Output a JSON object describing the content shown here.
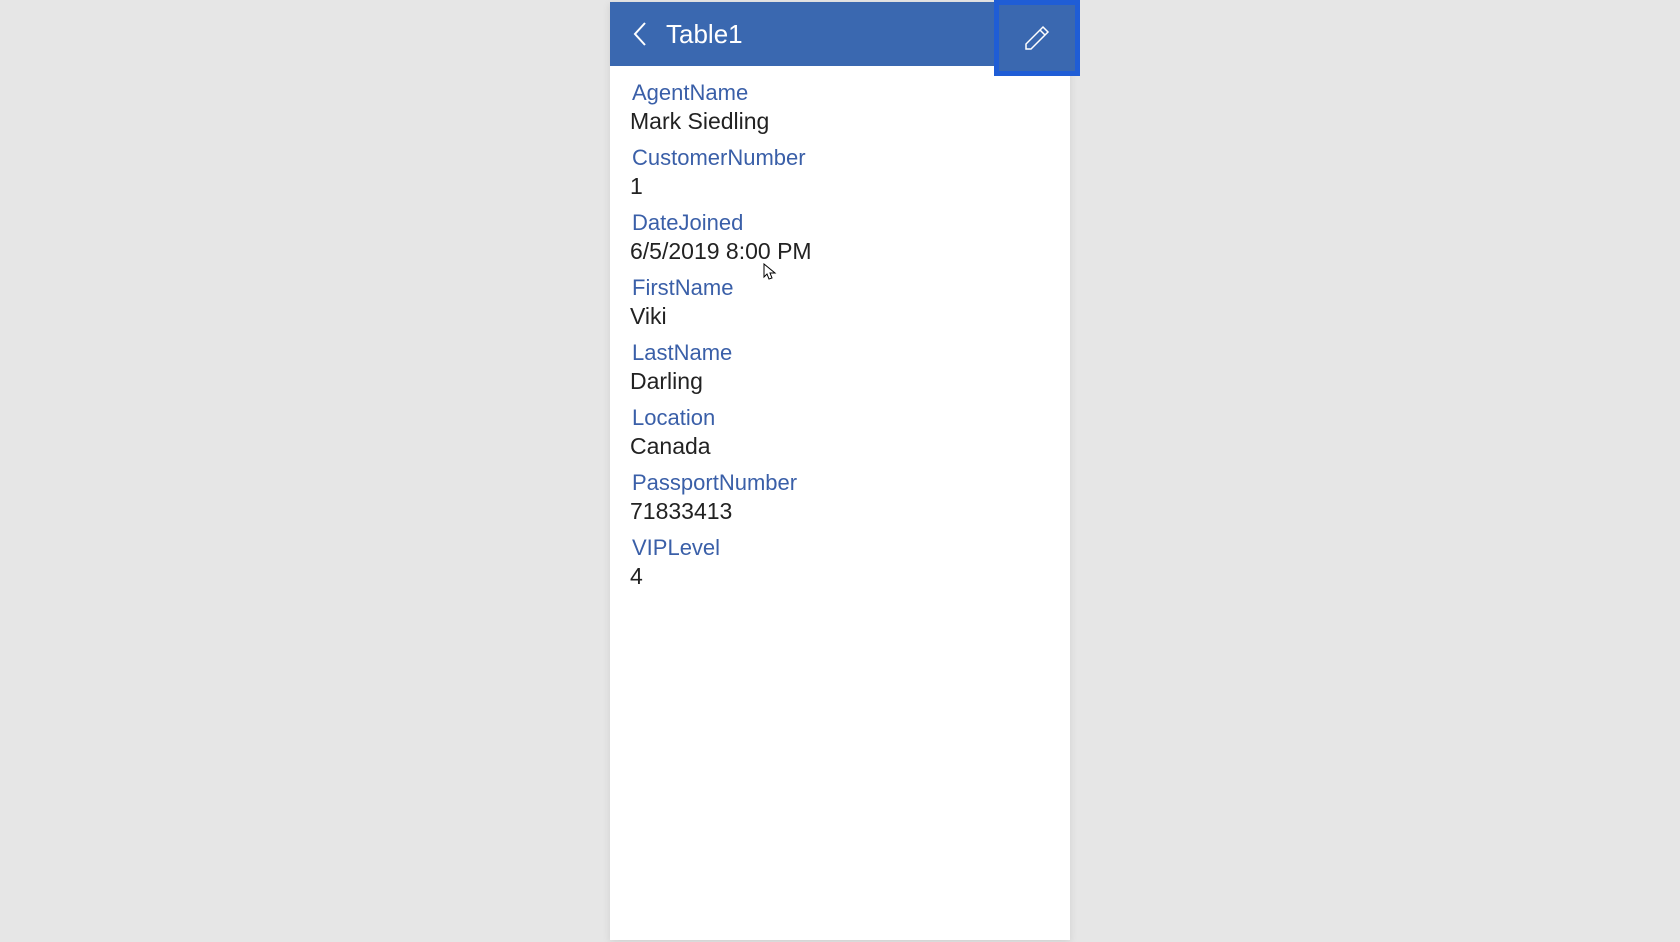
{
  "header": {
    "title": "Table1"
  },
  "fields": [
    {
      "label": "AgentName",
      "value": "Mark Siedling"
    },
    {
      "label": "CustomerNumber",
      "value": "1"
    },
    {
      "label": "DateJoined",
      "value": "6/5/2019 8:00 PM"
    },
    {
      "label": "FirstName",
      "value": "Viki"
    },
    {
      "label": "LastName",
      "value": "Darling"
    },
    {
      "label": "Location",
      "value": "Canada"
    },
    {
      "label": "PassportNumber",
      "value": "71833413"
    },
    {
      "label": "VIPLevel",
      "value": "4"
    }
  ]
}
